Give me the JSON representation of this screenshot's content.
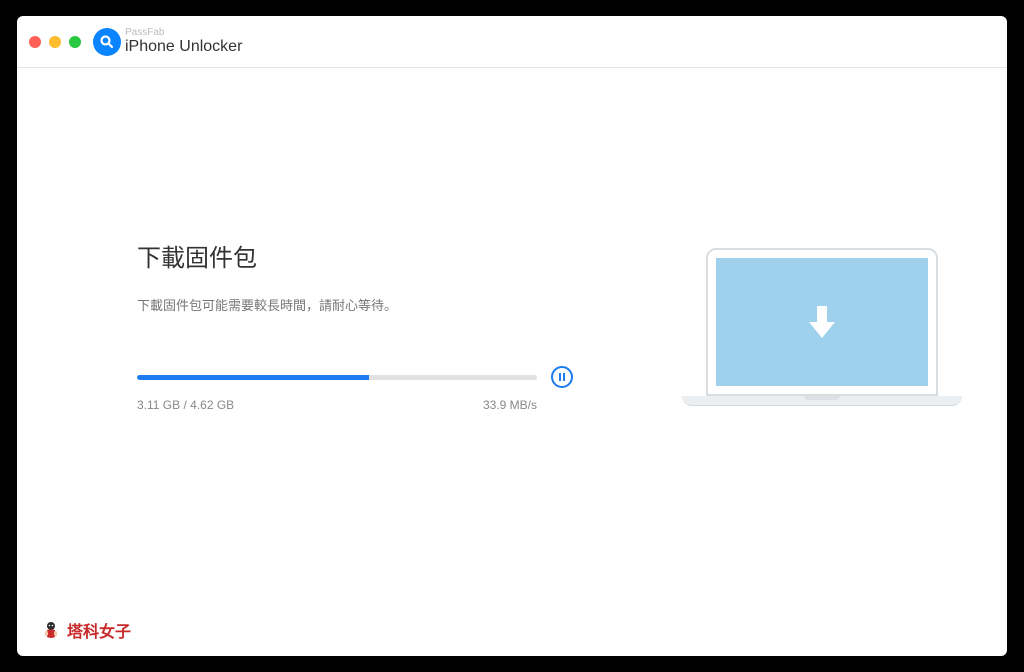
{
  "header": {
    "brand_super": "PassFab",
    "app_name": "iPhone Unlocker"
  },
  "download": {
    "heading": "下載固件包",
    "subtext": "下載固件包可能需要較長時間，請耐心等待。",
    "progress_percent": 58,
    "downloaded": "3.11 GB",
    "total_size": "4.62 GB",
    "size_separator": " / ",
    "speed": "33.9 MB/s"
  },
  "watermark": {
    "text": "塔科女子"
  },
  "colors": {
    "accent": "#1e7bf0",
    "illustration": "#9fd1ed"
  }
}
